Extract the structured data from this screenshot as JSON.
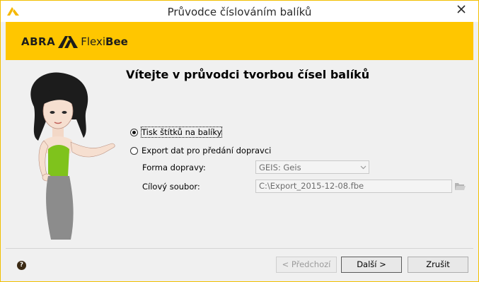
{
  "window": {
    "title": "Průvodce číslováním balíků"
  },
  "banner": {
    "logo_abra": "ABRA",
    "logo_flexi": "Flexi",
    "logo_bee": "Bee"
  },
  "content": {
    "heading": "Vítejte v průvodci tvorbou čísel balíků",
    "options": [
      {
        "label": "Tisk štítků na balíky",
        "checked": true
      },
      {
        "label": "Export dat pro předání dopravci",
        "checked": false
      }
    ],
    "shipping_label": "Forma dopravy:",
    "shipping_value": "GEIS: Geis",
    "target_label": "Cílový soubor:",
    "target_value": "C:\\Export_2015-12-08.fbe"
  },
  "footer": {
    "help": "?",
    "back": "< Předchozí",
    "next": "Další >",
    "cancel": "Zrušit"
  },
  "colors": {
    "accent": "#ffc600",
    "border": "#f2bf00"
  }
}
